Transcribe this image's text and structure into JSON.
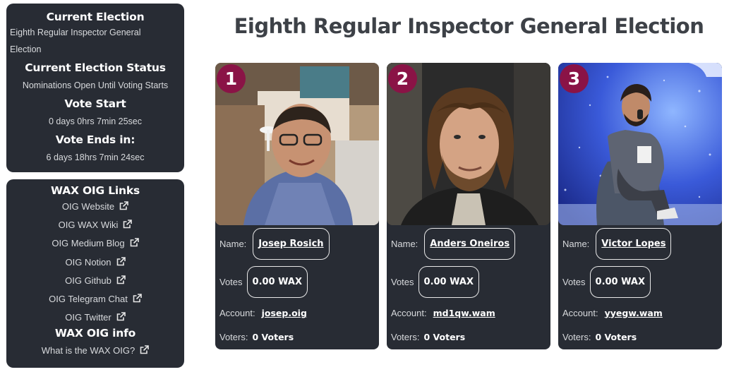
{
  "status_panel": {
    "current_election_heading": "Current Election",
    "current_election_line1": "Eighth Regular Inspector General",
    "current_election_line2": "Election",
    "status_heading": "Current Election Status",
    "status_value": "Nominations Open Until Voting Starts",
    "vote_start_heading": "Vote Start",
    "vote_start_value": "0 days 0hrs 7min 25sec",
    "vote_ends_heading": "Vote Ends in:",
    "vote_ends_value": "6 days 18hrs 7min 24sec"
  },
  "links_panel": {
    "heading": "WAX OIG Links",
    "links": [
      {
        "label": "OIG Website",
        "icon": "external-link-icon"
      },
      {
        "label": "OIG WAX Wiki",
        "icon": "external-link-icon"
      },
      {
        "label": "OIG Medium Blog",
        "icon": "external-link-icon"
      },
      {
        "label": "OIG Notion",
        "icon": "external-link-icon"
      },
      {
        "label": "OIG Github",
        "icon": "external-link-icon"
      },
      {
        "label": "OIG Telegram Chat",
        "icon": "external-link-icon"
      },
      {
        "label": "OIG Twitter",
        "icon": "external-link-icon"
      }
    ],
    "info_heading": "WAX OIG info",
    "info_link": {
      "label": "What is the WAX OIG?",
      "icon": "external-link-icon"
    }
  },
  "page_title": "Eighth Regular Inspector General Election",
  "labels": {
    "name": "Name:",
    "votes": "Votes",
    "account": "Account:",
    "voters": "Voters:"
  },
  "candidates": [
    {
      "rank": "1",
      "name": "Josep Rosich",
      "votes": "0.00 WAX",
      "account": "josep.oig",
      "voters": "0 Voters"
    },
    {
      "rank": "2",
      "name": "Anders Oneiros",
      "votes": "0.00 WAX",
      "account": "md1qw.wam",
      "voters": "0 Voters"
    },
    {
      "rank": "3",
      "name": "Victor Lopes",
      "votes": "0.00 WAX",
      "account": "yyegw.wam",
      "voters": "0 Voters"
    }
  ],
  "colors": {
    "panel_bg": "#282c34",
    "rank_badge": "#8a1346",
    "title_text": "#3d4147"
  }
}
